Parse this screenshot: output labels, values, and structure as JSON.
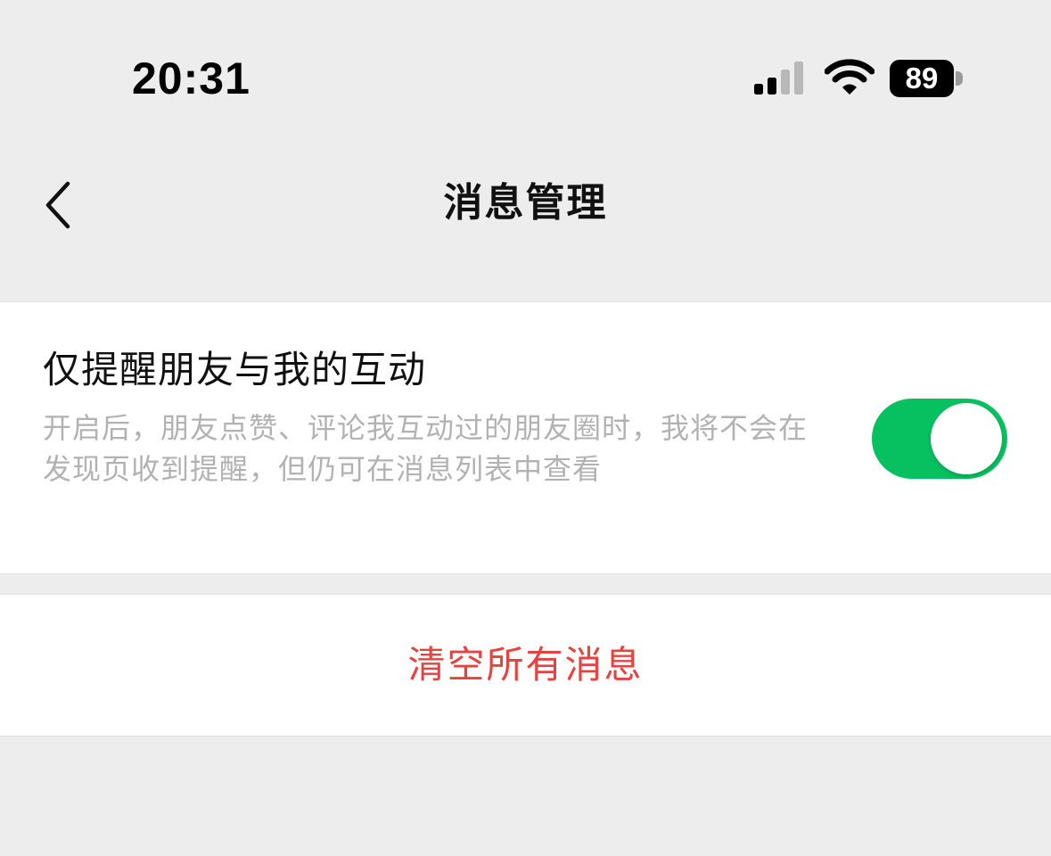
{
  "status_bar": {
    "time": "20:31",
    "battery_level": "89",
    "icons": [
      "signal-icon",
      "wifi-icon",
      "battery-icon"
    ]
  },
  "nav": {
    "title": "消息管理",
    "back_icon": "chevron-left-icon"
  },
  "settings": {
    "interaction_only": {
      "title": "仅提醒朋友与我的互动",
      "description": "开启后，朋友点赞、评论我互动过的朋友圈时，我将不会在发现页收到提醒，但仍可在消息列表中查看",
      "enabled": true
    }
  },
  "actions": {
    "clear_all": "清空所有消息"
  },
  "colors": {
    "background": "#ededed",
    "card": "#ffffff",
    "toggle_on": "#07c160",
    "danger": "#e64340",
    "secondary_text": "#b2b2b2"
  }
}
